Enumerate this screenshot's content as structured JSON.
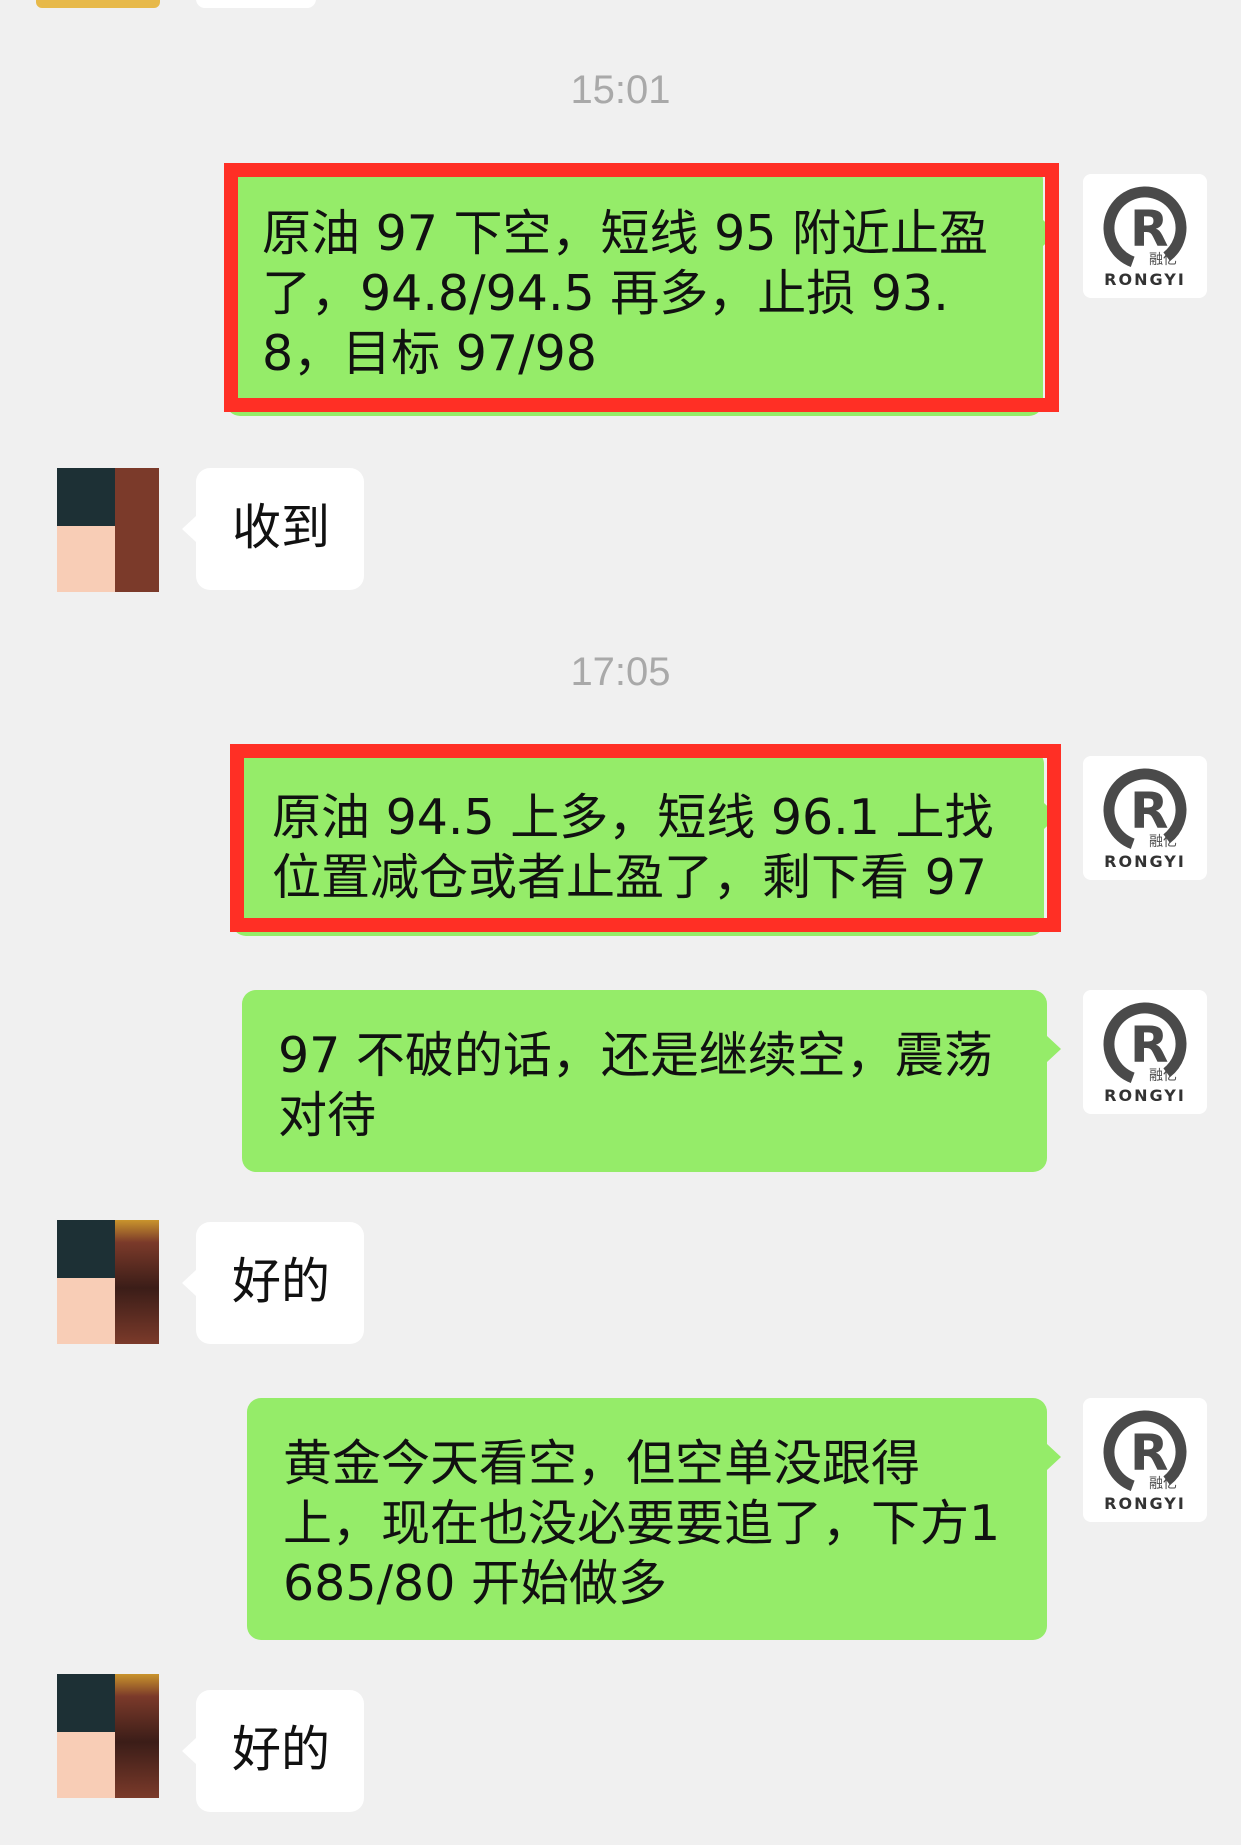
{
  "timestamps": [
    "15:01",
    "17:05"
  ],
  "messages": [
    {
      "text": "原油 97 下空，短线 95 附近止盈了，94.8/94.5 再多，止损 93.8，目标 97/98"
    },
    {
      "text": "收到"
    },
    {
      "text": "原油 94.5 上多，短线 96.1 上找位置减仓或者止盈了，剩下看 97"
    },
    {
      "text": "97 不破的话，还是继续空，震荡对待"
    },
    {
      "text": "好的"
    },
    {
      "text": "黄金今天看空，但空单没跟得上，现在也没必要要追了，下方1685/80 开始做多"
    },
    {
      "text": "好的"
    }
  ],
  "avatar": {
    "brand": "RONGYI",
    "cn": "融亿",
    "letter": "R"
  },
  "colors": {
    "background": "#f0f0f0",
    "outgoing_bubble": "#95ec69",
    "incoming_bubble": "#ffffff",
    "highlight_box": "#ff2f25",
    "timestamp": "#a9a9a9"
  }
}
